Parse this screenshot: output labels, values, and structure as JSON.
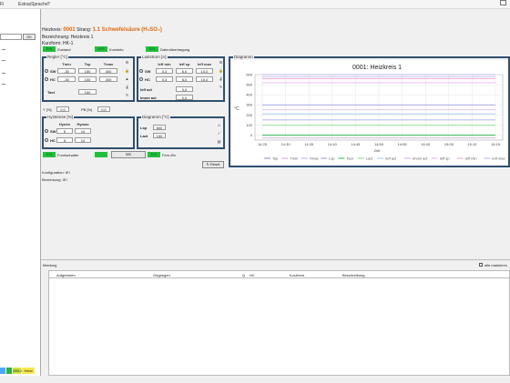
{
  "menubar": {
    "items": [
      "Extras",
      "Sprache",
      "?"
    ],
    "prefix": "Fi"
  },
  "left": {
    "ok": "OK",
    "tree_marks": 4,
    "status": [
      {
        "label": "",
        "color": "#4aa8ff"
      },
      {
        "label": "",
        "color": "#2ab049"
      },
      {
        "label": "ZEILEN",
        "color": "#c9e83a"
      },
      {
        "label": "Heist",
        "color": "#f7e84a"
      }
    ]
  },
  "header": {
    "heizkreis_label": "Heizkreis:",
    "heizkreis_num": "0001",
    "strang_label": "Strang:",
    "strang_value": "1.1 Schwefelsäure (H₂SO₄)",
    "bezeichnung": "Bezeichnung: Heizkreis 1",
    "kurzform": "Kurzform: HK-1"
  },
  "status_badges": [
    {
      "label": "EIN",
      "text": "Zustand"
    },
    {
      "label": "OFF",
      "text": "Kunststo"
    },
    {
      "label": "EIN",
      "text": "Datenübertragung"
    }
  ],
  "regler": {
    "title": "Regler [°C]",
    "cols": [
      "Tmin",
      "Tsp",
      "Tmax"
    ],
    "rows": [
      {
        "label": "SW",
        "vals": [
          "-30",
          "150",
          "300"
        ]
      },
      {
        "label": "HC",
        "vals": [
          "-30",
          "150",
          "300"
        ]
      }
    ],
    "tact_label": "Tact",
    "tact_value": "150",
    "y_label": "Y [%]",
    "y_value": "0,0",
    "pb_label": "PB [%]",
    "pb_value": "0,0"
  },
  "laststrom": {
    "title": "Laststrom [A]",
    "cols": [
      "Ieff min",
      "Ieff sp",
      "Ieff max"
    ],
    "rows": [
      {
        "label": "SW",
        "vals": [
          "0,3",
          "6,0",
          "10,0"
        ]
      },
      {
        "label": "HC",
        "vals": [
          "0,3",
          "6,0",
          "10,0"
        ]
      }
    ],
    "ieff_act_label": "Ieff act",
    "ieff_act_value": "0,0",
    "imom_act_label": "Imom act",
    "imom_act_value": "0,0"
  },
  "hysterese": {
    "title": "Hysterese [%]",
    "cols": [
      "Hymin",
      "Hymax"
    ],
    "rows": [
      {
        "label": "SW",
        "vals": [
          "5",
          "10"
        ]
      },
      {
        "label": "HC",
        "vals": [
          "5",
          "10"
        ]
      }
    ]
  },
  "diagramm_small": {
    "title": "Diagramm [°C]",
    "lsp_label": "Lsp",
    "lsp_value": "600",
    "lact_label": "Lact",
    "lact_value": "150"
  },
  "switches": [
    {
      "badge": "EIN",
      "text": "Frontschalter"
    },
    {
      "badge": "",
      "text": "SB!"
    },
    {
      "badge": "EIN",
      "text": "Fern-Ein"
    }
  ],
  "reset_label": "Reset",
  "konfiguration": "Konfiguration: IEI",
  "bemerkung": "Bemerkung: IEI",
  "diagram": {
    "group_title": "Diagramm",
    "chart_data": {
      "type": "line",
      "title": "0001: Heizkreis 1",
      "xlabel": "Zeit",
      "ylabel": "°C",
      "ylim": [
        -50,
        600
      ],
      "y_ticks": [
        "600",
        "500",
        "400",
        "300",
        "200",
        "100",
        "0"
      ],
      "x_ticks": [
        "14:25",
        "14:30",
        "14:35",
        "14:40",
        "14:45",
        "14:50",
        "14:55",
        "15:00",
        "15:05",
        "15:10",
        "15:15"
      ],
      "grid": true,
      "legend": "bottom",
      "series": [
        {
          "name": "Tsp",
          "color": "#8a8ad8",
          "values": [
            300,
            300,
            300,
            300,
            300,
            300,
            300,
            300,
            300,
            300,
            300
          ]
        },
        {
          "name": "Tmin",
          "color": "#c8a0d8",
          "values": [
            -30,
            -30,
            -30,
            -30,
            -30,
            -30,
            -30,
            -30,
            -30,
            -30,
            -30
          ]
        },
        {
          "name": "Tmax",
          "color": "#b0b0e8",
          "values": [
            600,
            600,
            600,
            600,
            600,
            600,
            600,
            600,
            600,
            600,
            600
          ]
        },
        {
          "name": "Lsp",
          "color": "#9a9ae8",
          "values": [
            150,
            150,
            150,
            150,
            150,
            150,
            150,
            150,
            150,
            150,
            150
          ]
        },
        {
          "name": "Tact",
          "color": "#2ab049",
          "values": [
            0,
            0,
            0,
            0,
            0,
            0,
            0,
            0,
            0,
            0,
            0
          ]
        },
        {
          "name": "Lact",
          "color": "#7adc7a",
          "values": [
            100,
            100,
            100,
            100,
            100,
            100,
            100,
            100,
            100,
            100,
            100
          ]
        },
        {
          "name": "Ieff act",
          "color": "#a0c8f0",
          "values": [
            210,
            210,
            210,
            210,
            210,
            210,
            210,
            210,
            210,
            210,
            210
          ]
        },
        {
          "name": "Imom act",
          "color": "#d0b0e0",
          "values": [
            250,
            250,
            250,
            250,
            250,
            250,
            250,
            250,
            250,
            250,
            250
          ]
        },
        {
          "name": "Ieff sp",
          "color": "#e0b0f0",
          "values": [
            520,
            520,
            520,
            520,
            520,
            520,
            520,
            520,
            520,
            520,
            520
          ]
        },
        {
          "name": "Ieff min",
          "color": "#f0a0d0",
          "values": [
            560,
            560,
            560,
            560,
            560,
            560,
            560,
            560,
            560,
            560,
            560
          ]
        },
        {
          "name": "Ieff max",
          "color": "#b0b0f0",
          "values": [
            580,
            580,
            580,
            580,
            580,
            580,
            580,
            580,
            580,
            580,
            580
          ]
        }
      ]
    }
  },
  "messages": {
    "title": "Meldung",
    "mark_all": "alle markieren",
    "columns": [
      "Aufgetreten",
      "Gegangen",
      "Q",
      "HC",
      "Kurzform",
      "Beschreibung"
    ]
  }
}
